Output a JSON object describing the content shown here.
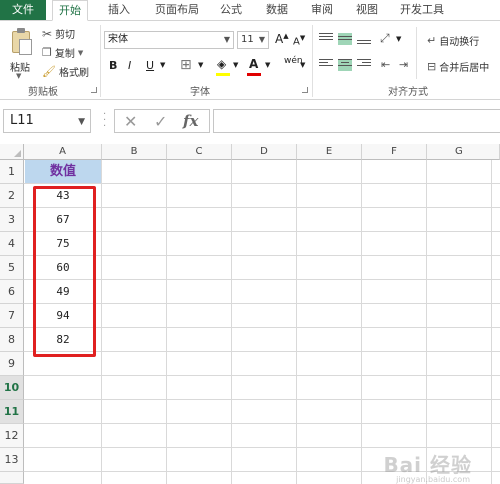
{
  "ribbon_tabs": [
    "文件",
    "开始",
    "插入",
    "页面布局",
    "公式",
    "数据",
    "审阅",
    "视图",
    "开发工具"
  ],
  "active_tab": "开始",
  "clipboard": {
    "paste_label": "粘贴",
    "cut_label": "剪切",
    "copy_label": "复制",
    "format_painter_label": "格式刷",
    "group_label": "剪贴板"
  },
  "font": {
    "font_name": "宋体",
    "font_size": "11",
    "bold": "B",
    "italic": "I",
    "underline": "U",
    "grow": "A",
    "shrink": "A",
    "font_color_letter": "A",
    "phonetic": "wén",
    "group_label": "字体"
  },
  "alignment": {
    "wrap_text_label": "自动换行",
    "merge_center_label": "合并后居中",
    "group_label": "对齐方式"
  },
  "formula_bar": {
    "name_box": "L11",
    "cancel_icon": "✕",
    "enter_icon": "✓",
    "fx_label": "fx",
    "formula": ""
  },
  "columns": [
    "A",
    "B",
    "C",
    "D",
    "E",
    "F",
    "G"
  ],
  "rows": [
    "1",
    "2",
    "3",
    "4",
    "5",
    "6",
    "7",
    "8",
    "9",
    "10",
    "11",
    "12",
    "13"
  ],
  "selected_rows": [
    "10",
    "11"
  ],
  "sheet": {
    "header": "数值",
    "values": [
      "43",
      "67",
      "75",
      "60",
      "49",
      "94",
      "82"
    ]
  },
  "colors": {
    "accent": "#217346",
    "header_fill": "#bdd7ee",
    "header_text": "#7030a0",
    "highlight_border": "#e02020"
  },
  "watermark": {
    "main": "Bai 经验",
    "sub": "jingyan.baidu.com"
  }
}
